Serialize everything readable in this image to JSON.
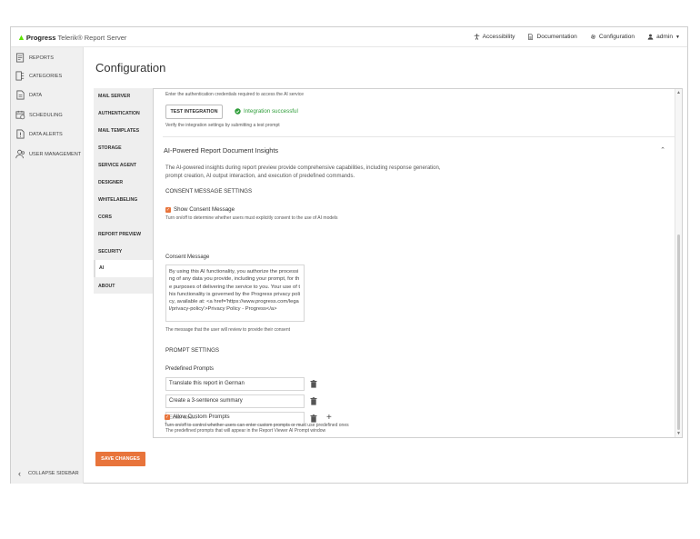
{
  "header": {
    "brand_progress": "Progress",
    "brand_rest": "Telerik® Report Server",
    "links": {
      "accessibility": "Accessibility",
      "documentation": "Documentation",
      "configuration": "Configuration",
      "admin": "admin"
    }
  },
  "sidebar": {
    "items": [
      {
        "label": "REPORTS",
        "icon": "reports-icon"
      },
      {
        "label": "CATEGORIES",
        "icon": "categories-icon"
      },
      {
        "label": "DATA",
        "icon": "data-icon"
      },
      {
        "label": "SCHEDULING",
        "icon": "scheduling-icon"
      },
      {
        "label": "DATA ALERTS",
        "icon": "data-alerts-icon"
      },
      {
        "label": "USER MANAGEMENT",
        "icon": "users-icon"
      }
    ],
    "collapse_label": "COLLAPSE SIDEBAR"
  },
  "page": {
    "title": "Configuration",
    "save_label": "SAVE CHANGES"
  },
  "config_tabs": [
    "MAIL SERVER",
    "AUTHENTICATION",
    "MAIL TEMPLATES",
    "STORAGE",
    "SERVICE AGENT",
    "DESIGNER",
    "WHITELABELING",
    "CORS",
    "REPORT PREVIEW",
    "SECURITY",
    "AI",
    "ABOUT"
  ],
  "active_tab": "AI",
  "ai": {
    "auth_hint": "Enter the authentication credentials required to access the AI service",
    "test_button": "TEST INTEGRATION",
    "test_status": "Integration successful",
    "test_hint": "Verify the integration settings by submitting a test prompt",
    "insights_title": "AI-Powered Report Document Insights",
    "insights_description": "The AI-powered insights during report preview provide comprehensive capabilities, including response generation, prompt creation, AI output interaction, and execution of predefined commands.",
    "consent_heading": "CONSENT MESSAGE SETTINGS",
    "show_consent_label": "Show Consent Message",
    "show_consent_checked": true,
    "show_consent_hint": "Turn on/off to determine whether users must explicitly consent to the use of AI models",
    "consent_message_label": "Consent Message",
    "consent_message_value": "By using this AI functionality, you authorize the processing of any data you provide, including your prompt, for the purposes of delivering the service to you. Your use of this functionality is governed by the Progress privacy policy, available at: <a href='https://www.progress.com/legal/privacy-policy'>Privacy Policy - Progress</a>",
    "consent_message_hint": "The message that the user will review to provide their consent",
    "prompt_heading": "PROMPT SETTINGS",
    "predefined_label": "Predefined Prompts",
    "prompts": [
      "Translate this report in German",
      "Create a 3-sentence summary"
    ],
    "new_prompt_placeholder": "Enter text...",
    "prompts_hint": "The predefined prompts that will appear in the Report Viewer AI Prompt window",
    "allow_custom_label": "Allow Custom Prompts",
    "allow_custom_checked": true,
    "allow_custom_hint": "Turn on/off to control whether users can enter custom prompts or must use predefined ones"
  },
  "colors": {
    "accent": "#e8743b",
    "success": "#2f9e3a",
    "brand_green": "#5ce500"
  }
}
